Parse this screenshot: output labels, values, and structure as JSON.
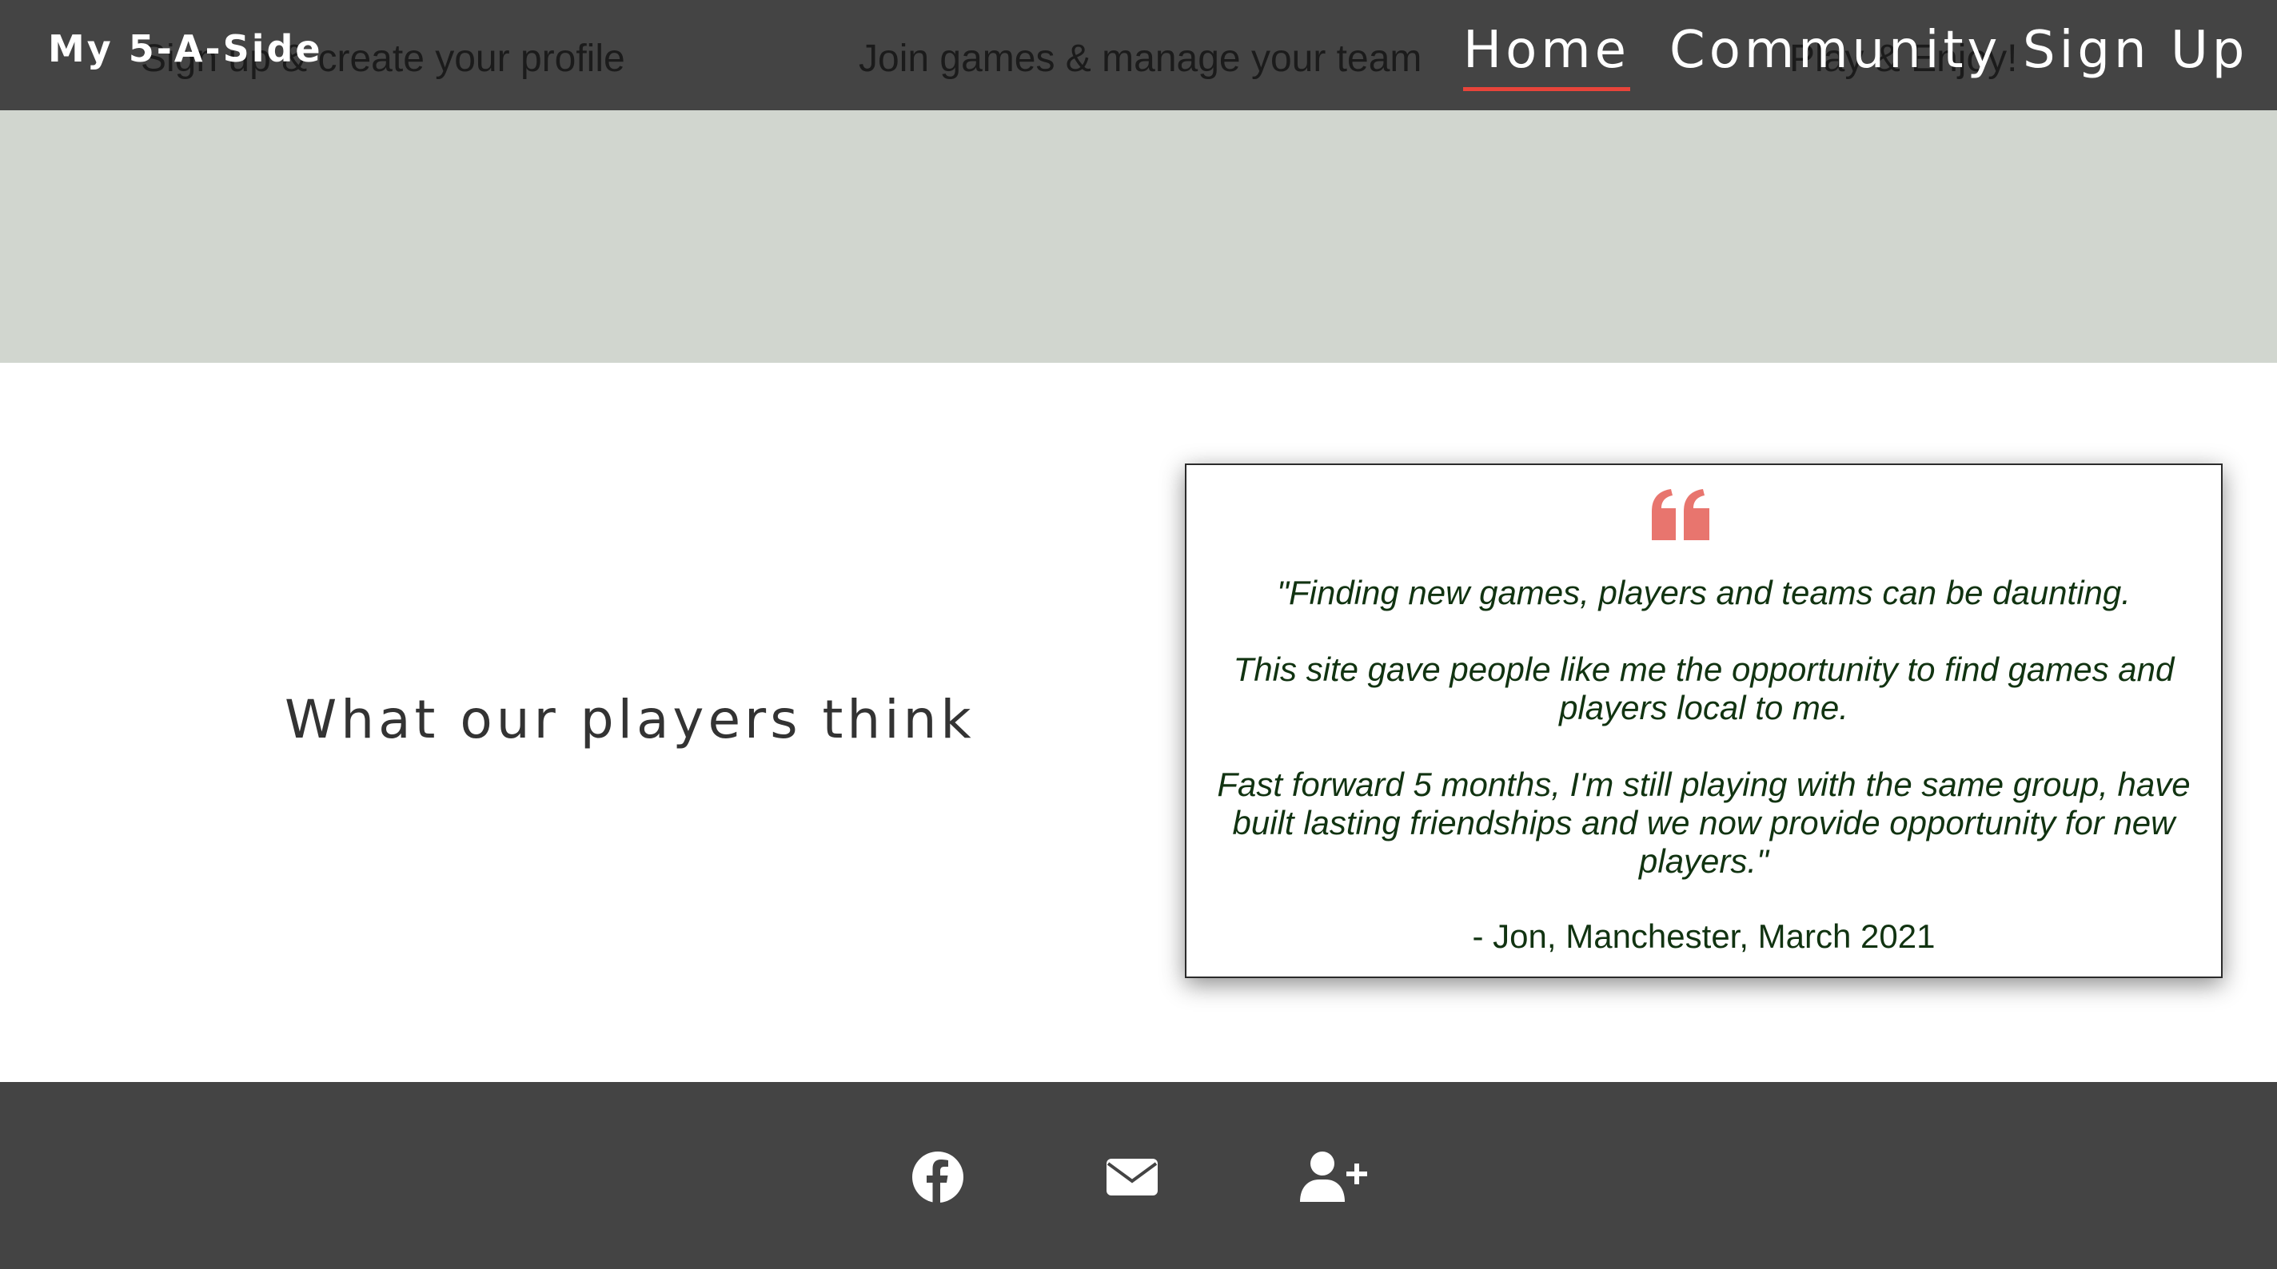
{
  "header": {
    "brand": "My 5-A-Side",
    "steps": [
      "Sign up & create your profile",
      "Join games & manage your team",
      "Play & Enjoy!"
    ],
    "nav": [
      {
        "label": "Home",
        "active": true
      },
      {
        "label": "Community",
        "active": false
      },
      {
        "label": "Sign Up",
        "active": false
      }
    ]
  },
  "testimonials": {
    "heading": "What our players think",
    "quote_icon": "quote-left-icon",
    "quote_lines": [
      "\"Finding new games, players and teams can be daunting.",
      "This site gave people like me the opportunity to find games and players local to me.",
      "Fast forward 5 months, I'm still playing with the same group, have built lasting friendships and we now provide opportunity for new players.\""
    ],
    "author": "- Jon, Manchester, March 2021"
  },
  "footer": {
    "icons": [
      "facebook-icon",
      "email-icon",
      "add-user-icon"
    ]
  },
  "colors": {
    "header_bg": "#444444",
    "band_bg": "#d1d6cf",
    "accent": "#e8443a",
    "quote_icon": "#e8756e",
    "quote_text": "#113311"
  }
}
